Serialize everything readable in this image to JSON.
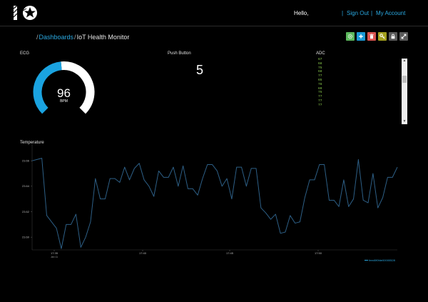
{
  "header": {
    "greeting": "Hello,",
    "sign_out": "Sign Out",
    "account": "My Account",
    "separator": "|"
  },
  "breadcrumb": {
    "sep": "/",
    "parent": "Dashboards",
    "current": "IoT Health Monitor"
  },
  "toolbar": [
    {
      "icon": "gear-icon",
      "color": "#5cb85c"
    },
    {
      "icon": "plus-icon",
      "color": "#1a9ad6"
    },
    {
      "icon": "trash-icon",
      "color": "#d9534f"
    },
    {
      "icon": "key-icon",
      "color": "#a3a01d"
    },
    {
      "icon": "lock-icon",
      "color": "#5b5b5b"
    },
    {
      "icon": "expand-icon",
      "color": "#5b5b5b"
    }
  ],
  "ecg": {
    "title": "ECG",
    "value": "96",
    "unit": "BPM",
    "fraction": 0.48,
    "fill_color": "#1aa3e0",
    "track_color": "#ffffff"
  },
  "push_button": {
    "title": "Push Button",
    "value": "5"
  },
  "adc": {
    "title": "ADC",
    "values": [
      "67",
      "68",
      "75",
      "68",
      "77",
      "65",
      "78",
      "69",
      "75",
      "77",
      "77",
      "77"
    ]
  },
  "chart_data": {
    "type": "line",
    "title": "Temperature",
    "ylim": [
      23.59,
      23.673
    ],
    "y_ticks": [
      23.6,
      23.62,
      23.64,
      23.66
    ],
    "y_tick_labels": [
      "23.60",
      "23.62",
      "23.64",
      "23.66"
    ],
    "x_tick_labels": [
      "17:35",
      "17:40",
      "17:45",
      "17:50"
    ],
    "x_sublabel": "Jan 11",
    "legend": "feed0f0fde00000528",
    "line_color": "#2d5f86",
    "series": [
      {
        "name": "feed0f0fde00000528",
        "values": [
          23.66,
          23.661,
          23.662,
          23.617,
          23.612,
          23.607,
          23.591,
          23.61,
          23.61,
          23.618,
          23.592,
          23.6,
          23.612,
          23.646,
          23.63,
          23.63,
          23.646,
          23.646,
          23.643,
          23.655,
          23.645,
          23.654,
          23.658,
          23.645,
          23.64,
          23.632,
          23.652,
          23.647,
          23.647,
          23.655,
          23.64,
          23.656,
          23.638,
          23.638,
          23.633,
          23.646,
          23.657,
          23.657,
          23.652,
          23.64,
          23.646,
          23.63,
          23.655,
          23.655,
          23.64,
          23.654,
          23.654,
          23.623,
          23.619,
          23.614,
          23.618,
          23.603,
          23.604,
          23.617,
          23.611,
          23.612,
          23.631,
          23.645,
          23.645,
          23.657,
          23.657,
          23.629,
          23.629,
          23.624,
          23.645,
          23.624,
          23.63,
          23.661,
          23.629,
          23.627,
          23.65,
          23.623,
          23.631,
          23.647,
          23.647,
          23.655
        ]
      }
    ]
  }
}
